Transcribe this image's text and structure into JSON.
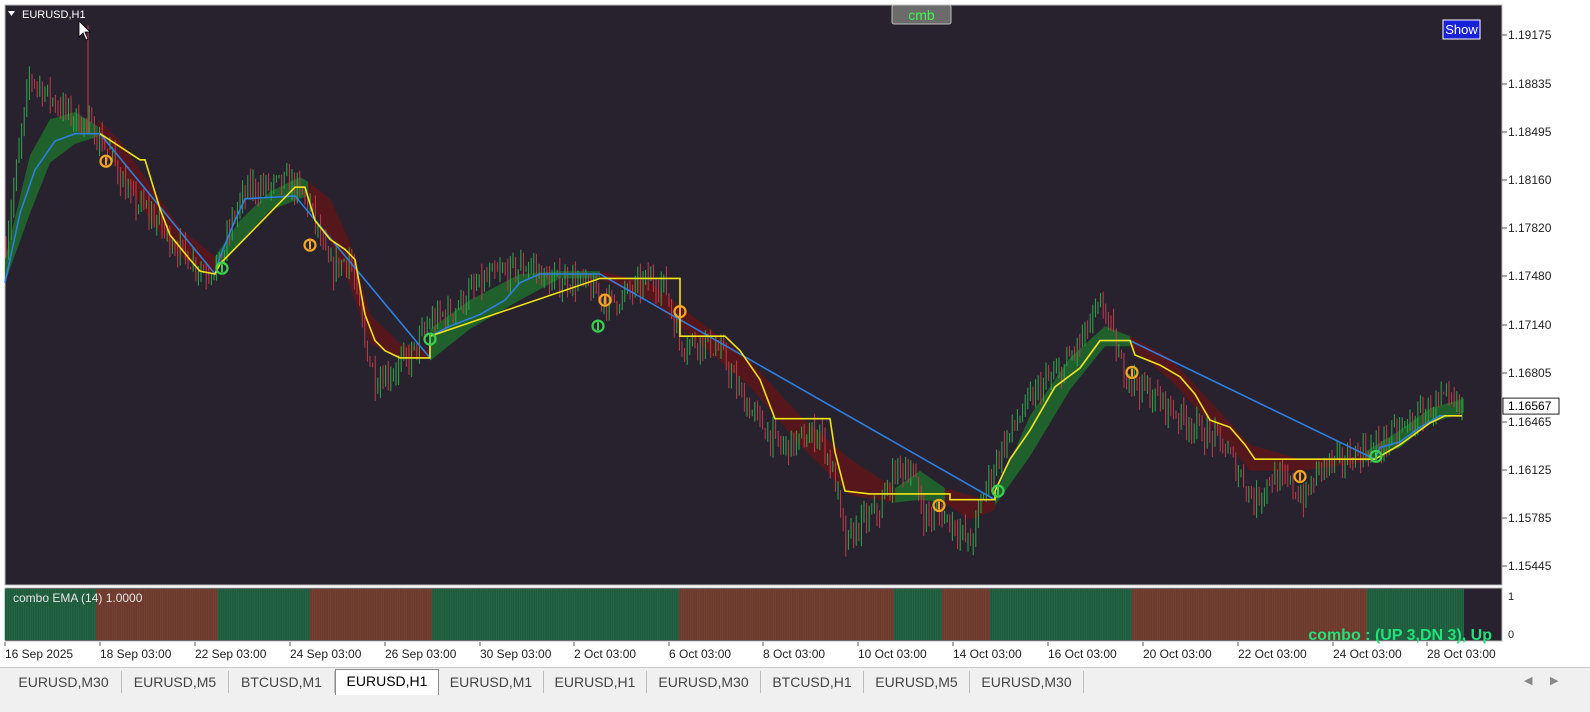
{
  "chart_window": {
    "symbol_title": "EURUSD,H1",
    "top_button": "cmb",
    "show_button": "Show",
    "current_price": "1.16567",
    "bg_color": "#27222e",
    "bull_color": "#2ea84a",
    "bear_color": "#c23a4a",
    "upper_line_color": "#f2e318",
    "lower_line_color": "#2f7fe0",
    "signal_color": "#f5a623",
    "up_signal_color": "#3ccf4e"
  },
  "price_axis": [
    "1.19175",
    "1.18835",
    "1.18495",
    "1.18160",
    "1.17820",
    "1.17480",
    "1.17140",
    "1.16805",
    "1.16465",
    "1.16125",
    "1.15785",
    "1.15445"
  ],
  "time_axis": [
    "16 Sep 2025",
    "18 Sep 03:00",
    "22 Sep 03:00",
    "24 Sep 03:00",
    "26 Sep 03:00",
    "30 Sep 03:00",
    "2 Oct 03:00",
    "6 Oct 03:00",
    "8 Oct 03:00",
    "10 Oct 03:00",
    "14 Oct 03:00",
    "16 Oct 03:00",
    "20 Oct 03:00",
    "22 Oct 03:00",
    "24 Oct 03:00",
    "28 Oct 03:00"
  ],
  "indicator": {
    "label": "combo EMA (14) 1.0000",
    "axis_top": "1",
    "axis_bottom": "0",
    "status": "combo : (UP 3,DN 3), Up",
    "status_color": "#22e27a"
  },
  "chart_data": {
    "type": "line",
    "ylim": [
      1.1533,
      1.1934
    ],
    "anchors": [
      [
        0,
        1.1742
      ],
      [
        30,
        1.1885
      ],
      [
        50,
        1.187
      ],
      [
        70,
        1.1858
      ],
      [
        90,
        1.185
      ],
      [
        110,
        1.1832
      ],
      [
        130,
        1.18
      ],
      [
        150,
        1.179
      ],
      [
        170,
        1.1772
      ],
      [
        190,
        1.1758
      ],
      [
        205,
        1.175
      ],
      [
        220,
        1.1755
      ],
      [
        235,
        1.179
      ],
      [
        250,
        1.1808
      ],
      [
        270,
        1.1808
      ],
      [
        290,
        1.1812
      ],
      [
        310,
        1.1795
      ],
      [
        330,
        1.175
      ],
      [
        350,
        1.176
      ],
      [
        365,
        1.17
      ],
      [
        375,
        1.1676
      ],
      [
        390,
        1.168
      ],
      [
        410,
        1.169
      ],
      [
        430,
        1.1715
      ],
      [
        450,
        1.1722
      ],
      [
        470,
        1.1735
      ],
      [
        490,
        1.1745
      ],
      [
        510,
        1.175
      ],
      [
        530,
        1.1755
      ],
      [
        550,
        1.1742
      ],
      [
        570,
        1.1745
      ],
      [
        590,
        1.1738
      ],
      [
        610,
        1.1728
      ],
      [
        630,
        1.1735
      ],
      [
        650,
        1.1745
      ],
      [
        665,
        1.174
      ],
      [
        680,
        1.17
      ],
      [
        700,
        1.1702
      ],
      [
        720,
        1.1695
      ],
      [
        740,
        1.1665
      ],
      [
        760,
        1.1645
      ],
      [
        780,
        1.1628
      ],
      [
        800,
        1.1632
      ],
      [
        820,
        1.164
      ],
      [
        835,
        1.1605
      ],
      [
        845,
        1.156
      ],
      [
        860,
        1.1575
      ],
      [
        880,
        1.1585
      ],
      [
        895,
        1.1612
      ],
      [
        910,
        1.1615
      ],
      [
        925,
        1.158
      ],
      [
        940,
        1.1582
      ],
      [
        955,
        1.1575
      ],
      [
        970,
        1.156
      ],
      [
        985,
        1.16
      ],
      [
        1000,
        1.1625
      ],
      [
        1020,
        1.165
      ],
      [
        1040,
        1.167
      ],
      [
        1060,
        1.168
      ],
      [
        1080,
        1.17
      ],
      [
        1095,
        1.172
      ],
      [
        1105,
        1.1725
      ],
      [
        1120,
        1.1685
      ],
      [
        1140,
        1.167
      ],
      [
        1160,
        1.166
      ],
      [
        1180,
        1.165
      ],
      [
        1200,
        1.164
      ],
      [
        1220,
        1.1632
      ],
      [
        1240,
        1.161
      ],
      [
        1255,
        1.159
      ],
      [
        1270,
        1.1608
      ],
      [
        1290,
        1.1602
      ],
      [
        1305,
        1.1592
      ],
      [
        1320,
        1.1615
      ],
      [
        1340,
        1.1618
      ],
      [
        1360,
        1.1625
      ],
      [
        1380,
        1.163
      ],
      [
        1400,
        1.164
      ],
      [
        1420,
        1.165
      ],
      [
        1440,
        1.166
      ],
      [
        1460,
        1.1655
      ],
      [
        1464,
        1.16567
      ]
    ],
    "upper_line": [
      [
        100,
        1.1845
      ],
      [
        140,
        1.1827
      ],
      [
        145,
        1.1827
      ],
      [
        160,
        1.1793
      ],
      [
        170,
        1.1775
      ],
      [
        190,
        1.1758
      ],
      [
        200,
        1.175
      ],
      [
        215,
        1.1748
      ],
      [
        220,
        1.1755
      ],
      [
        295,
        1.1808
      ],
      [
        305,
        1.1808
      ],
      [
        315,
        1.1785
      ],
      [
        330,
        1.1772
      ],
      [
        345,
        1.1765
      ],
      [
        355,
        1.1758
      ],
      [
        365,
        1.172
      ],
      [
        375,
        1.1702
      ],
      [
        385,
        1.1695
      ],
      [
        400,
        1.169
      ],
      [
        430,
        1.169
      ],
      [
        430,
        1.1705
      ],
      [
        600,
        1.1745
      ],
      [
        680,
        1.1745
      ],
      [
        680,
        1.1705
      ],
      [
        725,
        1.1705
      ],
      [
        740,
        1.1695
      ],
      [
        760,
        1.1675
      ],
      [
        775,
        1.1648
      ],
      [
        830,
        1.1648
      ],
      [
        835,
        1.1625
      ],
      [
        845,
        1.1598
      ],
      [
        870,
        1.1596
      ],
      [
        950,
        1.1596
      ],
      [
        950,
        1.1592
      ],
      [
        995,
        1.1592
      ],
      [
        995,
        1.1598
      ],
      [
        1010,
        1.162
      ],
      [
        1030,
        1.164
      ],
      [
        1055,
        1.167
      ],
      [
        1080,
        1.1683
      ],
      [
        1100,
        1.1702
      ],
      [
        1130,
        1.1702
      ],
      [
        1135,
        1.1692
      ],
      [
        1160,
        1.1685
      ],
      [
        1180,
        1.1677
      ],
      [
        1195,
        1.1665
      ],
      [
        1210,
        1.1647
      ],
      [
        1230,
        1.1642
      ],
      [
        1245,
        1.163
      ],
      [
        1255,
        1.162
      ],
      [
        1290,
        1.162
      ],
      [
        1375,
        1.162
      ],
      [
        1400,
        1.163
      ],
      [
        1430,
        1.1645
      ],
      [
        1445,
        1.165
      ],
      [
        1462,
        1.165
      ]
    ],
    "lower_line": [
      [
        5,
        1.1742
      ],
      [
        20,
        1.179
      ],
      [
        35,
        1.182
      ],
      [
        55,
        1.184
      ],
      [
        75,
        1.1845
      ],
      [
        100,
        1.1845
      ],
      [
        215,
        1.1748
      ],
      [
        220,
        1.176
      ],
      [
        235,
        1.1785
      ],
      [
        245,
        1.18
      ],
      [
        295,
        1.1802
      ],
      [
        430,
        1.169
      ],
      [
        430,
        1.1705
      ],
      [
        450,
        1.1712
      ],
      [
        480,
        1.172
      ],
      [
        505,
        1.173
      ],
      [
        520,
        1.1742
      ],
      [
        540,
        1.1748
      ],
      [
        600,
        1.1748
      ],
      [
        995,
        1.1592
      ],
      [
        995,
        1.1598
      ],
      [
        1010,
        1.162
      ],
      [
        1030,
        1.164
      ],
      [
        1055,
        1.167
      ],
      [
        1080,
        1.1683
      ],
      [
        1100,
        1.1702
      ],
      [
        1130,
        1.1702
      ],
      [
        1375,
        1.162
      ],
      [
        1380,
        1.1628
      ],
      [
        1400,
        1.1632
      ],
      [
        1420,
        1.1642
      ],
      [
        1440,
        1.165
      ],
      [
        1462,
        1.165
      ]
    ],
    "cloud_bands": [
      {
        "type": "bull",
        "from": 5,
        "to": 98,
        "top": [
          [
            5,
            1.1758
          ],
          [
            30,
            1.183
          ],
          [
            50,
            1.1855
          ],
          [
            75,
            1.186
          ],
          [
            98,
            1.185
          ]
        ],
        "bottom": [
          [
            5,
            1.1742
          ],
          [
            30,
            1.179
          ],
          [
            50,
            1.1825
          ],
          [
            75,
            1.1838
          ],
          [
            98,
            1.1843
          ]
        ]
      },
      {
        "type": "bear",
        "from": 98,
        "to": 215,
        "top": [
          [
            98,
            1.1855
          ],
          [
            120,
            1.184
          ],
          [
            150,
            1.181
          ],
          [
            180,
            1.178
          ],
          [
            215,
            1.176
          ]
        ],
        "bottom": [
          [
            98,
            1.1843
          ],
          [
            120,
            1.182
          ],
          [
            150,
            1.1785
          ],
          [
            180,
            1.176
          ],
          [
            215,
            1.1748
          ]
        ]
      },
      {
        "type": "bull",
        "from": 215,
        "to": 308,
        "top": [
          [
            215,
            1.176
          ],
          [
            240,
            1.1785
          ],
          [
            270,
            1.1805
          ],
          [
            300,
            1.1815
          ],
          [
            308,
            1.1812
          ]
        ],
        "bottom": [
          [
            215,
            1.1752
          ],
          [
            240,
            1.177
          ],
          [
            270,
            1.1792
          ],
          [
            300,
            1.18
          ],
          [
            308,
            1.1802
          ]
        ]
      },
      {
        "type": "bear",
        "from": 308,
        "to": 430,
        "top": [
          [
            308,
            1.1812
          ],
          [
            330,
            1.18
          ],
          [
            350,
            1.177
          ],
          [
            370,
            1.172
          ],
          [
            400,
            1.17
          ],
          [
            430,
            1.1695
          ]
        ],
        "bottom": [
          [
            308,
            1.1802
          ],
          [
            330,
            1.177
          ],
          [
            350,
            1.174
          ],
          [
            370,
            1.17
          ],
          [
            400,
            1.169
          ],
          [
            430,
            1.169
          ]
        ]
      },
      {
        "type": "bull",
        "from": 430,
        "to": 600,
        "top": [
          [
            430,
            1.171
          ],
          [
            470,
            1.173
          ],
          [
            520,
            1.1748
          ],
          [
            560,
            1.175
          ],
          [
            600,
            1.175
          ]
        ],
        "bottom": [
          [
            430,
            1.1688
          ],
          [
            470,
            1.171
          ],
          [
            520,
            1.173
          ],
          [
            560,
            1.1745
          ],
          [
            600,
            1.1745
          ]
        ]
      },
      {
        "type": "bear",
        "from": 600,
        "to": 895,
        "top": [
          [
            600,
            1.175
          ],
          [
            650,
            1.1742
          ],
          [
            700,
            1.1715
          ],
          [
            750,
            1.1688
          ],
          [
            800,
            1.165
          ],
          [
            850,
            1.162
          ],
          [
            895,
            1.16
          ]
        ],
        "bottom": [
          [
            600,
            1.1745
          ],
          [
            650,
            1.173
          ],
          [
            700,
            1.17
          ],
          [
            750,
            1.167
          ],
          [
            800,
            1.163
          ],
          [
            850,
            1.1595
          ],
          [
            895,
            1.159
          ]
        ]
      },
      {
        "type": "bull",
        "from": 895,
        "to": 945,
        "top": [
          [
            895,
            1.16
          ],
          [
            920,
            1.1612
          ],
          [
            945,
            1.16
          ]
        ],
        "bottom": [
          [
            895,
            1.159
          ],
          [
            920,
            1.1592
          ],
          [
            945,
            1.159
          ]
        ]
      },
      {
        "type": "bear",
        "from": 945,
        "to": 995,
        "top": [
          [
            945,
            1.16
          ],
          [
            970,
            1.1595
          ],
          [
            995,
            1.159
          ]
        ],
        "bottom": [
          [
            945,
            1.159
          ],
          [
            970,
            1.1578
          ],
          [
            995,
            1.1585
          ]
        ]
      },
      {
        "type": "bull",
        "from": 995,
        "to": 1130,
        "top": [
          [
            995,
            1.1595
          ],
          [
            1030,
            1.165
          ],
          [
            1070,
            1.169
          ],
          [
            1105,
            1.1712
          ],
          [
            1130,
            1.1705
          ]
        ],
        "bottom": [
          [
            995,
            1.1588
          ],
          [
            1030,
            1.1622
          ],
          [
            1070,
            1.1668
          ],
          [
            1105,
            1.1698
          ],
          [
            1130,
            1.1698
          ]
        ]
      },
      {
        "type": "bear",
        "from": 1130,
        "to": 1365,
        "top": [
          [
            1130,
            1.1705
          ],
          [
            1170,
            1.169
          ],
          [
            1210,
            1.166
          ],
          [
            1250,
            1.163
          ],
          [
            1300,
            1.162
          ],
          [
            1365,
            1.1622
          ]
        ],
        "bottom": [
          [
            1130,
            1.1698
          ],
          [
            1170,
            1.1675
          ],
          [
            1210,
            1.1645
          ],
          [
            1250,
            1.1612
          ],
          [
            1300,
            1.1612
          ],
          [
            1365,
            1.1618
          ]
        ]
      },
      {
        "type": "bull",
        "from": 1365,
        "to": 1464,
        "top": [
          [
            1365,
            1.1625
          ],
          [
            1400,
            1.164
          ],
          [
            1430,
            1.1655
          ],
          [
            1464,
            1.1662
          ]
        ],
        "bottom": [
          [
            1365,
            1.1618
          ],
          [
            1400,
            1.1628
          ],
          [
            1430,
            1.1645
          ],
          [
            1464,
            1.1652
          ]
        ]
      }
    ],
    "signals": [
      {
        "x": 106,
        "price": 1.1826,
        "dir": "down"
      },
      {
        "x": 222,
        "price": 1.1752,
        "dir": "up"
      },
      {
        "x": 310,
        "price": 1.1768,
        "dir": "down"
      },
      {
        "x": 430,
        "price": 1.1703,
        "dir": "up"
      },
      {
        "x": 605,
        "price": 1.173,
        "dir": "down"
      },
      {
        "x": 598,
        "price": 1.1712,
        "dir": "up"
      },
      {
        "x": 680,
        "price": 1.1722,
        "dir": "down"
      },
      {
        "x": 939,
        "price": 1.1588,
        "dir": "down"
      },
      {
        "x": 998,
        "price": 1.1598,
        "dir": "up"
      },
      {
        "x": 1132,
        "price": 1.168,
        "dir": "down"
      },
      {
        "x": 1300,
        "price": 1.1608,
        "dir": "down"
      },
      {
        "x": 1376,
        "price": 1.1622,
        "dir": "up"
      }
    ],
    "indicator_segments": [
      {
        "from": 5,
        "to": 96,
        "trend": "up"
      },
      {
        "from": 96,
        "to": 218,
        "trend": "down"
      },
      {
        "from": 218,
        "to": 310,
        "trend": "up"
      },
      {
        "from": 310,
        "to": 432,
        "trend": "down"
      },
      {
        "from": 432,
        "to": 679,
        "trend": "up"
      },
      {
        "from": 679,
        "to": 894,
        "trend": "down"
      },
      {
        "from": 894,
        "to": 942,
        "trend": "up"
      },
      {
        "from": 942,
        "to": 990,
        "trend": "down"
      },
      {
        "from": 990,
        "to": 1132,
        "trend": "up"
      },
      {
        "from": 1132,
        "to": 1367,
        "trend": "down"
      },
      {
        "from": 1367,
        "to": 1464,
        "trend": "up"
      }
    ]
  },
  "tabs": [
    {
      "label": "EURUSD,M30",
      "active": false
    },
    {
      "label": "EURUSD,M5",
      "active": false
    },
    {
      "label": "BTCUSD,M1",
      "active": false
    },
    {
      "label": "EURUSD,H1",
      "active": true
    },
    {
      "label": "EURUSD,M1",
      "active": false
    },
    {
      "label": "EURUSD,H1",
      "active": false
    },
    {
      "label": "EURUSD,M30",
      "active": false
    },
    {
      "label": "BTCUSD,H1",
      "active": false
    },
    {
      "label": "EURUSD,M5",
      "active": false
    },
    {
      "label": "EURUSD,M30",
      "active": false
    }
  ],
  "tab_nav": {
    "prev": "◀",
    "next": "▶"
  }
}
